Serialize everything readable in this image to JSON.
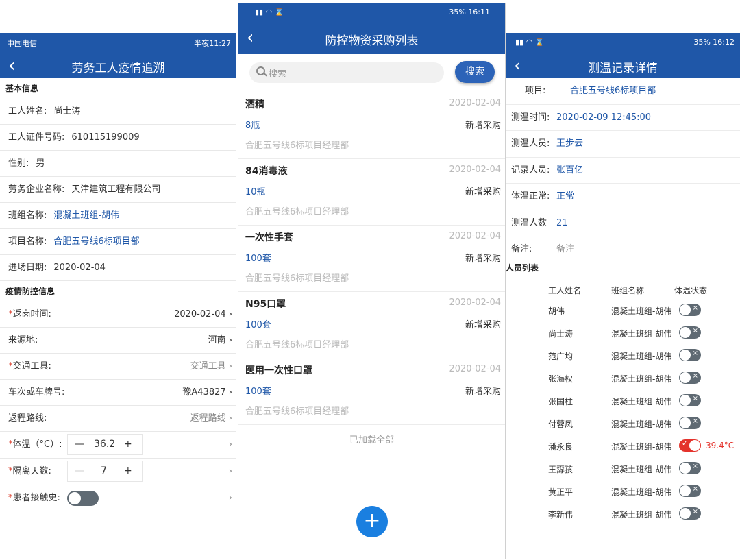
{
  "left": {
    "status_left": "中国电信",
    "status_right": "半夜11:27",
    "title": "劳务工人疫情追溯",
    "sec_basic": "基本信息",
    "basic": [
      {
        "k": "工人姓名:",
        "v": "尚士涛"
      },
      {
        "k": "工人证件号码:",
        "v": "610115199009"
      },
      {
        "k": "性别:",
        "v": "男"
      },
      {
        "k": "劳务企业名称:",
        "v": "天津建筑工程有限公司"
      },
      {
        "k": "班组名称:",
        "v": "混凝土班组-胡伟"
      },
      {
        "k": "项目名称:",
        "v": "合肥五号线6标项目部"
      },
      {
        "k": "进场日期:",
        "v": "2020-02-04"
      }
    ],
    "sec_epi": "疫情防控信息",
    "epi": [
      {
        "req": "*",
        "k": "返岗时间:",
        "v": "2020-02-04"
      },
      {
        "req": "",
        "k": "来源地:",
        "v": "河南"
      },
      {
        "req": "*",
        "k": "交通工具:",
        "v": "交通工具"
      },
      {
        "req": "",
        "k": "车次或车牌号:",
        "v": "豫A43827"
      },
      {
        "req": "",
        "k": "返程路线:",
        "v": "返程路线"
      }
    ],
    "temp_label": "体温（°C）:",
    "temp_value": "36.2",
    "days_label": "隔离天数:",
    "days_value": "7",
    "contact_label": "患者接触史:",
    "minus": "—",
    "plus": "+",
    "req": "*"
  },
  "middle": {
    "status_right": "35% 16:11",
    "title": "防控物资采购列表",
    "search_placeholder": "搜索",
    "search_button": "搜索",
    "items": [
      {
        "name": "酒精",
        "date": "2020-02-04",
        "qty": "8瓶",
        "status": "新增采购",
        "dept": "合肥五号线6标项目经理部"
      },
      {
        "name": "84消毒液",
        "date": "2020-02-04",
        "qty": "10瓶",
        "status": "新增采购",
        "dept": "合肥五号线6标项目经理部"
      },
      {
        "name": "一次性手套",
        "date": "2020-02-04",
        "qty": "100套",
        "status": "新增采购",
        "dept": "合肥五号线6标项目经理部"
      },
      {
        "name": "N95口罩",
        "date": "2020-02-04",
        "qty": "100套",
        "status": "新增采购",
        "dept": "合肥五号线6标项目经理部"
      },
      {
        "name": "医用一次性口罩",
        "date": "2020-02-04",
        "qty": "100套",
        "status": "新增采购",
        "dept": "合肥五号线6标项目经理部"
      }
    ],
    "loaded": "已加载全部",
    "fab": "+"
  },
  "right": {
    "status_right": "35% 16:12",
    "title": "测温记录详情",
    "details": [
      {
        "k": "项目:",
        "v": "合肥五号线6标项目部"
      },
      {
        "k": "测温时间:",
        "v": "2020-02-09 12:45:00"
      },
      {
        "k": "测温人员:",
        "v": "王步云"
      },
      {
        "k": "记录人员:",
        "v": "张百亿"
      },
      {
        "k": "体温正常:",
        "v": "正常"
      },
      {
        "k": "测温人数",
        "v": "21"
      },
      {
        "k": "备注:",
        "v": "备注"
      }
    ],
    "list_title": "人员列表",
    "headers": [
      "工人姓名",
      "班组名称",
      "体温状态"
    ],
    "people": [
      {
        "name": "胡伟",
        "team": "混凝土班组-胡伟",
        "on": false,
        "temp": ""
      },
      {
        "name": "尚士涛",
        "team": "混凝土班组-胡伟",
        "on": false,
        "temp": ""
      },
      {
        "name": "范广均",
        "team": "混凝土班组-胡伟",
        "on": false,
        "temp": ""
      },
      {
        "name": "张海权",
        "team": "混凝土班组-胡伟",
        "on": false,
        "temp": ""
      },
      {
        "name": "张国柱",
        "team": "混凝土班组-胡伟",
        "on": false,
        "temp": ""
      },
      {
        "name": "付蓉凤",
        "team": "混凝土班组-胡伟",
        "on": false,
        "temp": ""
      },
      {
        "name": "潘永良",
        "team": "混凝土班组-胡伟",
        "on": true,
        "temp": "39.4°C"
      },
      {
        "name": "王孬孩",
        "team": "混凝土班组-胡伟",
        "on": false,
        "temp": ""
      },
      {
        "name": "黄正平",
        "team": "混凝土班组-胡伟",
        "on": false,
        "temp": ""
      },
      {
        "name": "李新伟",
        "team": "混凝土班组-胡伟",
        "on": false,
        "temp": ""
      }
    ],
    "toggle_off_mark": "×",
    "toggle_on_mark": "✓"
  }
}
